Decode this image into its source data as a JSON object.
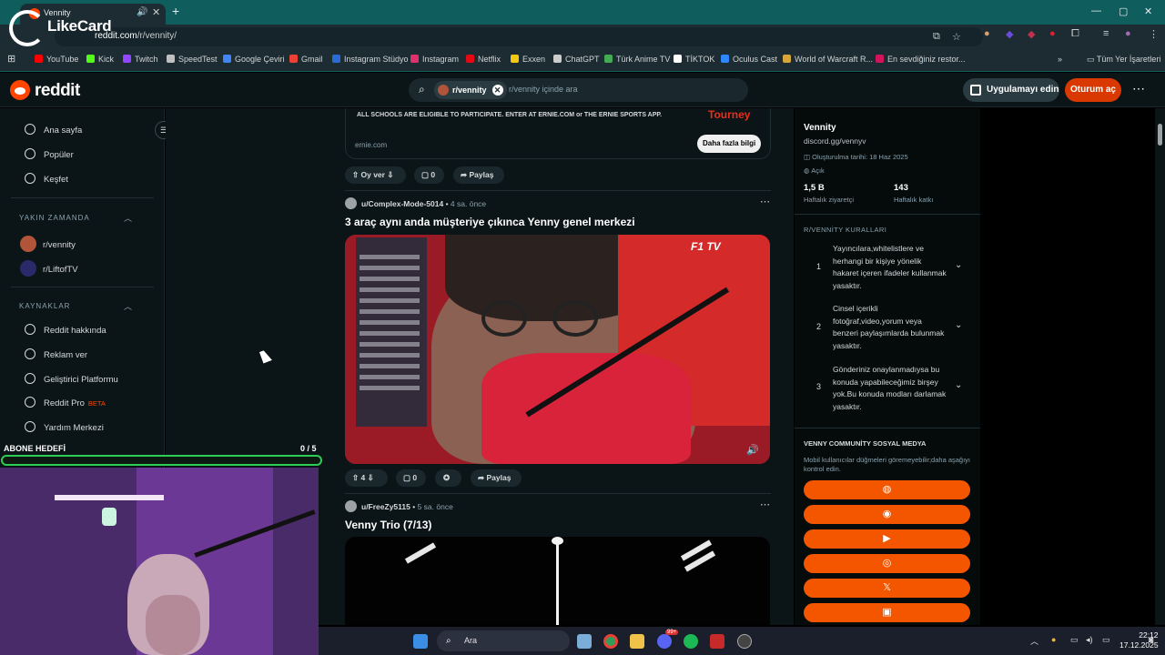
{
  "browser": {
    "tab_title": "Vennity",
    "url_host": "reddit.com",
    "url_path": "/r/vennity/",
    "overlay_logo": "LikeCard",
    "bookmarks": [
      {
        "label": "YouTube",
        "color": "#ff0000"
      },
      {
        "label": "Kick",
        "color": "#53fc18"
      },
      {
        "label": "Twitch",
        "color": "#9146ff"
      },
      {
        "label": "SpeedTest",
        "color": "#c0c0c0"
      },
      {
        "label": "Google Çeviri",
        "color": "#4285f4"
      },
      {
        "label": "Gmail",
        "color": "#ea4335"
      },
      {
        "label": "Instagram Stüdyo",
        "color": "#2b6cd4"
      },
      {
        "label": "Instagram",
        "color": "#e1306c"
      },
      {
        "label": "Netflix",
        "color": "#e50914"
      },
      {
        "label": "Exxen",
        "color": "#f2c811"
      },
      {
        "label": "ChatGPT",
        "color": "#cccccc"
      },
      {
        "label": "Türk Anime TV",
        "color": "#44aa55"
      },
      {
        "label": "TİKTOK",
        "color": "#ffffff"
      },
      {
        "label": "Oculus Cast",
        "color": "#2d88ff"
      },
      {
        "label": "World of Warcraft R...",
        "color": "#d8a53a"
      },
      {
        "label": "En sevdiğiniz restor...",
        "color": "#d4145a"
      }
    ],
    "all_bookmarks": "Tüm Yer İşaretleri"
  },
  "header": {
    "logo_text": "reddit",
    "search_chip": "r/vennity",
    "search_placeholder": "r/vennity içinde ara",
    "get_app": "Uygulamayı edin",
    "login": "Oturum aç"
  },
  "sidebar": {
    "main": [
      {
        "label": "Ana sayfa",
        "icon": "home-icon"
      },
      {
        "label": "Popüler",
        "icon": "popular-icon"
      },
      {
        "label": "Keşfet",
        "icon": "explore-icon"
      }
    ],
    "recent_title": "YAKIN ZAMANDA",
    "recent": [
      {
        "label": "r/vennity",
        "color": "#b2543a"
      },
      {
        "label": "r/LiftofTV",
        "color": "#2a2a6a"
      }
    ],
    "resources_title": "KAYNAKLAR",
    "resources": [
      {
        "label": "Reddit hakkında",
        "icon": "reddit-icon"
      },
      {
        "label": "Reklam ver",
        "icon": "megaphone-icon"
      },
      {
        "label": "Geliştirici Platformu",
        "icon": "gear-icon"
      },
      {
        "label": "Reddit Pro",
        "icon": "pro-icon",
        "badge": "BETA"
      },
      {
        "label": "Yardım Merkezi",
        "icon": "help-icon"
      }
    ]
  },
  "ad": {
    "text": "ALL SCHOOLS ARE ELIGIBLE TO PARTICIPATE. ENTER AT ERNIE.COM or THE ERNIE SPORTS APP.",
    "brand": "Tourney",
    "domain": "ernie.com",
    "cta": "Daha fazla bilgi",
    "vote_label": "Oy ver",
    "comments": "0",
    "share": "Paylaş"
  },
  "posts": [
    {
      "author": "u/Complex-Mode-5014",
      "time": "4 sa. önce",
      "title": "3 araç aynı anda müşteriye çıkınca Yenny genel merkezi",
      "media_badge": "F1 TV",
      "votes": "4",
      "comments": "0",
      "share": "Paylaş"
    },
    {
      "author": "u/FreeZy5115",
      "time": "5 sa. önce",
      "title": "Venny Trio (7/13)"
    }
  ],
  "community": {
    "name": "Vennity",
    "link": "discord.gg/vennyv",
    "created": "Oluşturulma tarihi: 18 Haz 2025",
    "visibility": "Açık",
    "weekly_visitors_value": "1,5 B",
    "weekly_visitors_label": "Haftalık ziyaretçi",
    "weekly_contrib_value": "143",
    "weekly_contrib_label": "Haftalık katkı",
    "rules_title": "R/VENNİTY KURALLARI",
    "rules": [
      {
        "n": "1",
        "text": "Yayıncılara,whitelistlere ve herhangi bir kişiye yönelik hakaret içeren ifadeler kullanmak yasaktır."
      },
      {
        "n": "2",
        "text": "Cinsel içerikli fotoğraf,video,yorum veya benzeri paylaşımlarda bulunmak yasaktır."
      },
      {
        "n": "3",
        "text": "Gönderiniz onaylanmadıysa bu konuda yapabileceğimiz birşey yok.Bu konuda modları darlamak yasaktır."
      }
    ],
    "social_title": "VENNY COMMUNİTY SOSYAL MEDYA",
    "social_desc": "Mobil kullanıcılar düğmeleri göremeyebilir;daha aşağıyı kontrol edin.",
    "social_buttons": [
      "globe-icon",
      "discord-icon",
      "youtube-icon",
      "instagram-icon",
      "x-icon",
      "twitch-icon"
    ]
  },
  "stream": {
    "goal_label": "ABONE HEDEFİ",
    "goal_count": "0 / 5"
  },
  "taskbar": {
    "search": "Ara",
    "time": "22:12",
    "date": "17.12.2025",
    "notif_badge": "99+"
  }
}
